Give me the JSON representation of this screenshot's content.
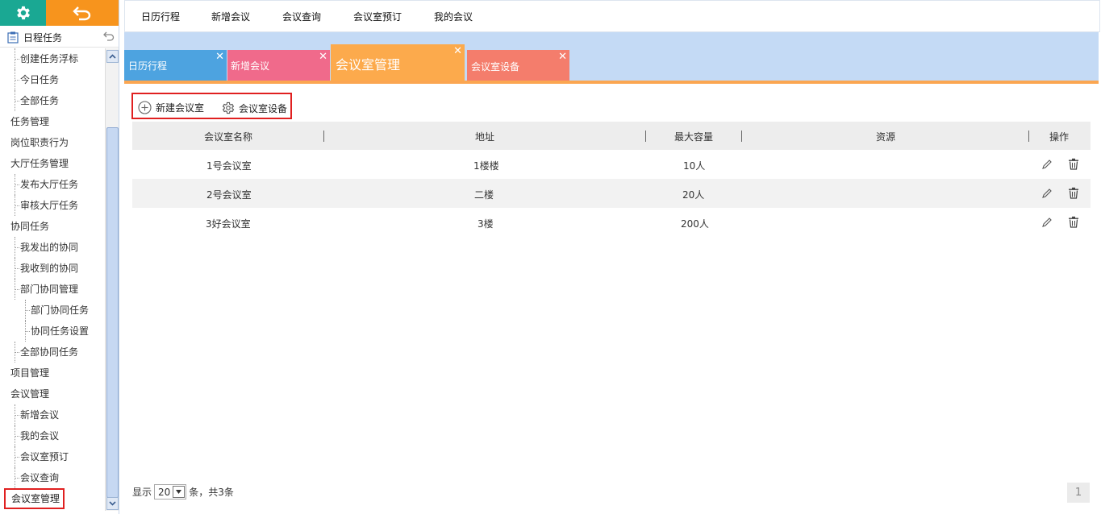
{
  "sidebar": {
    "header": "日程任务",
    "items": [
      {
        "label": "创建任务浮标",
        "level": 2
      },
      {
        "label": "今日任务",
        "level": 2
      },
      {
        "label": "全部任务",
        "level": 2
      },
      {
        "label": "任务管理",
        "level": 1
      },
      {
        "label": "岗位职责行为",
        "level": 1
      },
      {
        "label": "大厅任务管理",
        "level": 1
      },
      {
        "label": "发布大厅任务",
        "level": 2
      },
      {
        "label": "审核大厅任务",
        "level": 2
      },
      {
        "label": "协同任务",
        "level": 1
      },
      {
        "label": "我发出的协同",
        "level": 2
      },
      {
        "label": "我收到的协同",
        "level": 2
      },
      {
        "label": "部门协同管理",
        "level": 2
      },
      {
        "label": "部门协同任务",
        "level": 3
      },
      {
        "label": "协同任务设置",
        "level": 3
      },
      {
        "label": "全部协同任务",
        "level": 2
      },
      {
        "label": "项目管理",
        "level": 1
      },
      {
        "label": "会议管理",
        "level": 1
      },
      {
        "label": "新增会议",
        "level": 2
      },
      {
        "label": "我的会议",
        "level": 2
      },
      {
        "label": "会议室预订",
        "level": 2
      },
      {
        "label": "会议查询",
        "level": 2
      }
    ],
    "selected": "会议室管理"
  },
  "topmenu": [
    "日历行程",
    "新增会议",
    "会议查询",
    "会议室预订",
    "我的会议"
  ],
  "tabs": [
    {
      "label": "日历行程",
      "color": "#4da3e0"
    },
    {
      "label": "新增会议",
      "color": "#f06a8b"
    },
    {
      "label": "会议室管理",
      "color": "#fcaa4c",
      "active": true
    },
    {
      "label": "会议室设备",
      "color": "#f47d6c"
    }
  ],
  "toolbar": {
    "new_room": "新建会议室",
    "equipment": "会议室设备"
  },
  "table": {
    "columns": [
      "会议室名称",
      "地址",
      "最大容量",
      "资源",
      "操作"
    ],
    "rows": [
      {
        "name": "1号会议室",
        "address": "1楼楼",
        "capacity": "10人",
        "resource": ""
      },
      {
        "name": "2号会议室",
        "address": "二楼",
        "capacity": "20人",
        "resource": ""
      },
      {
        "name": "3好会议室",
        "address": "3楼",
        "capacity": "200人",
        "resource": ""
      }
    ]
  },
  "pager": {
    "prefix": "显示",
    "page_size": "20",
    "suffix": "条，共3条",
    "current_page": "1"
  }
}
